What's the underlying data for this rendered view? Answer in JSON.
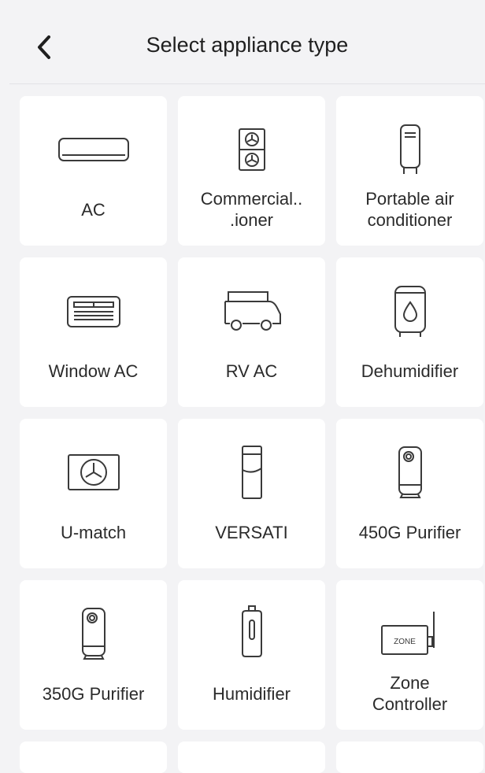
{
  "header": {
    "title": "Select appliance type",
    "back_icon": "chevron-left-icon"
  },
  "appliances": [
    {
      "label": "AC",
      "icon": "split-ac-icon"
    },
    {
      "label": "Commercial..\n.ioner",
      "icon": "commercial-ac-icon"
    },
    {
      "label": "Portable air\nconditioner",
      "icon": "portable-ac-icon"
    },
    {
      "label": "Window AC",
      "icon": "window-ac-icon"
    },
    {
      "label": "RV AC",
      "icon": "rv-icon"
    },
    {
      "label": "Dehumidifier",
      "icon": "dehumidifier-icon"
    },
    {
      "label": "U-match",
      "icon": "outdoor-unit-icon"
    },
    {
      "label": "VERSATI",
      "icon": "versati-icon"
    },
    {
      "label": "450G Purifier",
      "icon": "purifier-icon"
    },
    {
      "label": "350G Purifier",
      "icon": "purifier-icon"
    },
    {
      "label": "Humidifier",
      "icon": "humidifier-icon"
    },
    {
      "label": "Zone\nController",
      "icon": "zone-controller-icon",
      "icon_text": "ZONE"
    }
  ],
  "colors": {
    "background": "#f3f3f5",
    "card": "#ffffff",
    "text": "#2b2b2b"
  }
}
